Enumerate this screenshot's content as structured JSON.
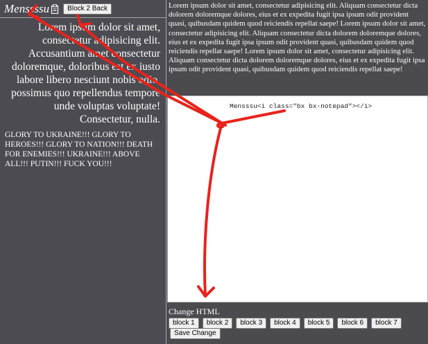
{
  "header": {
    "title": "Menssssu",
    "back_label": "Block 2 Back"
  },
  "left": {
    "paragraph": "Lorem ipsum dolor sit amet, consectetur adipisicing elit. Accusantium amet consectetur doloremque, doloribus est ex iusto labore libero nesciunt nobis odio, possimus quo repellendus tempore unde voluptas voluptate! Consectetur, nulla.",
    "caps": "GLORY TO UKRAINE!!! GLORY TO HEROES!!! GLORY TO NATION!!! DEATH FOR ENEMIES!!! UKRAINE!!! ABOVE ALL!!! PUTIN!!! FUCK YOU!!!"
  },
  "right": {
    "paragraph": "Lorem ipsum dolor sit amet, consectetur adipisicing elit. Aliquam consectetur dicta dolorem doloremque dolores, eius et ex expedita fugit ipsa ipsum odit provident quasi, quibusdam quidem quod reiciendis repellat saepe! Lorem ipsum dolor sit amet, consectetur adipisicing elit. Aliquam consectetur dicta dolorem doloremque dolores, eius et ex expedita fugit ipsa ipsum odit provident quasi, quibusdam quidem quod reiciendis repellat saepe! Lorem ipsum dolor sit amet, consectetur adipisicing elit. Aliquam consectetur dicta dolorem doloremque dolores, eius et ex expedita fugit ipsa ipsum odit provident quasi, quibusdam quidem quod reiciendis repellat saepe!"
  },
  "editor": {
    "value": "Mensssu<i class=\"bx bx-notepad\"></i>"
  },
  "controls": {
    "change_label": "Change HTML",
    "blocks": [
      "block 1",
      "block 2",
      "block 3",
      "block 4",
      "block 5",
      "block 6",
      "block 7"
    ],
    "save_label": "Save Change"
  },
  "icons": {
    "title_icon": "notepad-icon"
  },
  "colors": {
    "background": "#4b4b51",
    "annotation": "#e8231c",
    "editor_bg": "#ffffff"
  }
}
